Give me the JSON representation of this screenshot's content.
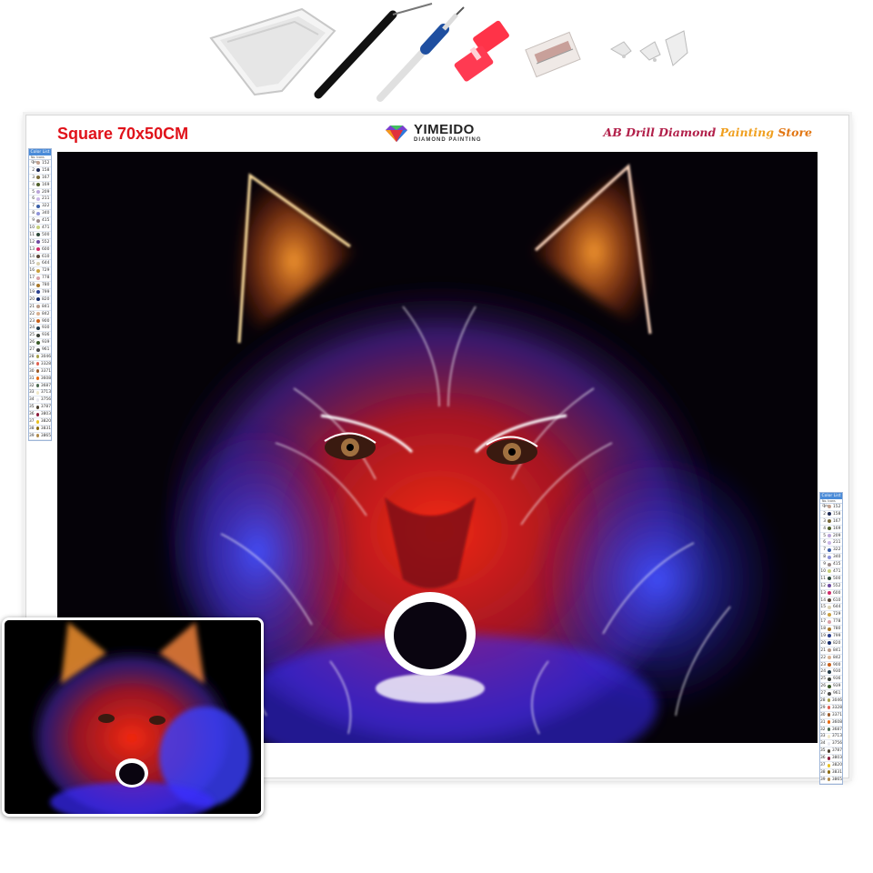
{
  "canvas": {
    "size_label": "Square 70x50CM",
    "brand_name": "YIMEIDO",
    "brand_sub": "DIAMOND PAINTING",
    "store_parts": [
      "AB Drill ",
      "Diamond ",
      "Painting ",
      "Store"
    ]
  },
  "color_list": {
    "title": "Color List",
    "header": "No.  Icons  Color",
    "codes": [
      "152",
      "158",
      "167",
      "169",
      "209",
      "211",
      "322",
      "340",
      "415",
      "471",
      "500",
      "552",
      "600",
      "610",
      "644",
      "729",
      "778",
      "780",
      "799",
      "820",
      "841",
      "842",
      "900",
      "930",
      "936",
      "939",
      "961",
      "3046",
      "3328",
      "3371",
      "3608",
      "3687",
      "3713",
      "3756",
      "3787",
      "3803",
      "3820",
      "3831",
      "3865"
    ],
    "dot_colors": [
      "#c2a18f",
      "#1e2a55",
      "#7a6b3a",
      "#4e5f2a",
      "#b9a3d8",
      "#c9b6e6",
      "#3b5fa8",
      "#8e93d9",
      "#9a8a8a",
      "#c6cf7a",
      "#2e4a3a",
      "#6e4aa0",
      "#d02a6a",
      "#5a4a3a",
      "#d9d0b0",
      "#c9a040",
      "#d8a0a8",
      "#a8782a",
      "#2a3f8e",
      "#142a6a",
      "#b89a88",
      "#d8b090",
      "#c8601a",
      "#223a4a",
      "#3a4038",
      "#3a5a28",
      "#4a4a4a",
      "#a8a04a",
      "#e06050",
      "#9a5a2a",
      "#e86a10",
      "#4a6a50",
      "#f0e8c8",
      "#e8e8f0",
      "#4a4030",
      "#8a1a3a",
      "#e8c020",
      "#8a6a10",
      "#b08a4a"
    ]
  },
  "tools": {
    "items": [
      "drill-tray-icon",
      "tweezers-icon",
      "pen-icon",
      "glue-clay-icon",
      "wax-pack-icon",
      "point-tips-icon"
    ],
    "colors": {
      "glue": "#ff3348",
      "pen_grip": "#1f4fa0"
    }
  },
  "artwork": {
    "subject": "neon-wolf",
    "palette": [
      "#ff2a10",
      "#ff8a1a",
      "#3040ff",
      "#9a30ff",
      "#ffffff"
    ]
  }
}
